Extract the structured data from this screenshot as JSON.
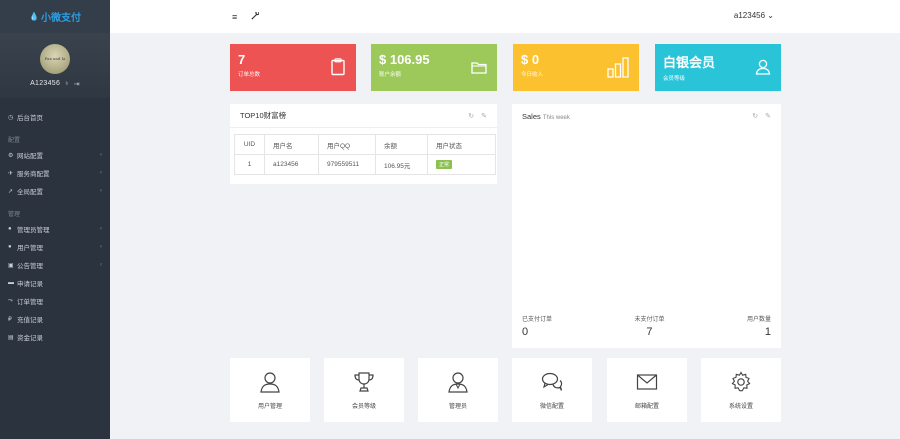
{
  "brand": {
    "name": "小微支付"
  },
  "profile": {
    "username": "A123456",
    "avatar_text": "Pax and la"
  },
  "sidebar": {
    "items": [
      {
        "label": "后台首页",
        "icon": "clock-icon",
        "section": ""
      },
      {
        "label": "网站配置",
        "icon": "gear-icon",
        "section": "配置",
        "chevron": true
      },
      {
        "label": "服务商配置",
        "icon": "plane-icon",
        "chevron": true
      },
      {
        "label": "全局配置",
        "icon": "wrench-icon",
        "chevron": true
      },
      {
        "label": "管理员管理",
        "icon": "user-icon",
        "section": "管理",
        "chevron": true
      },
      {
        "label": "用户管理",
        "icon": "users-icon",
        "chevron": true
      },
      {
        "label": "公告管理",
        "icon": "notice-icon",
        "chevron": true
      },
      {
        "label": "申请记录",
        "icon": "list-icon"
      },
      {
        "label": "订单管理",
        "icon": "chart-icon"
      },
      {
        "label": "充值记录",
        "icon": "money-icon"
      },
      {
        "label": "资金记录",
        "icon": "wallet-icon"
      }
    ],
    "sections": {
      "config": "配置",
      "manage": "管理"
    }
  },
  "topbar": {
    "user": "a123456",
    "menu_icon": "≡",
    "tool_icon": "🔧"
  },
  "cards": [
    {
      "value": "7",
      "label": "订单总数",
      "color": "#ee5354",
      "icon": "clipboard-icon"
    },
    {
      "value": "$ 106.95",
      "label": "账户余额",
      "color": "#9dc85a",
      "icon": "folder-icon"
    },
    {
      "value": "$ 0",
      "label": "今日收入",
      "color": "#fcc12e",
      "icon": "bars-icon"
    },
    {
      "value": "白银会员",
      "label": "会员等级",
      "color": "#2ac4d9",
      "icon": "user-outline-icon"
    }
  ],
  "top10": {
    "title": "TOP10财富榜",
    "columns": [
      "UID",
      "用户名",
      "用户QQ",
      "余额",
      "用户状态"
    ],
    "rows": [
      {
        "uid": "1",
        "username": "a123456",
        "qq": "979559511",
        "balance": "106.95元",
        "status": "正常"
      }
    ]
  },
  "sales": {
    "title": "Sales",
    "period": "This week",
    "stats": [
      {
        "label": "已支付订单",
        "value": "0"
      },
      {
        "label": "未支付订单",
        "value": "7"
      },
      {
        "label": "用户数量",
        "value": "1"
      }
    ]
  },
  "tiles": [
    {
      "label": "用户管理",
      "icon": "user-icon"
    },
    {
      "label": "会员等级",
      "icon": "trophy-icon"
    },
    {
      "label": "管理员",
      "icon": "admin-icon"
    },
    {
      "label": "微信配置",
      "icon": "chat-icon"
    },
    {
      "label": "邮箱配置",
      "icon": "mail-icon"
    },
    {
      "label": "系统设置",
      "icon": "gear-icon"
    }
  ]
}
